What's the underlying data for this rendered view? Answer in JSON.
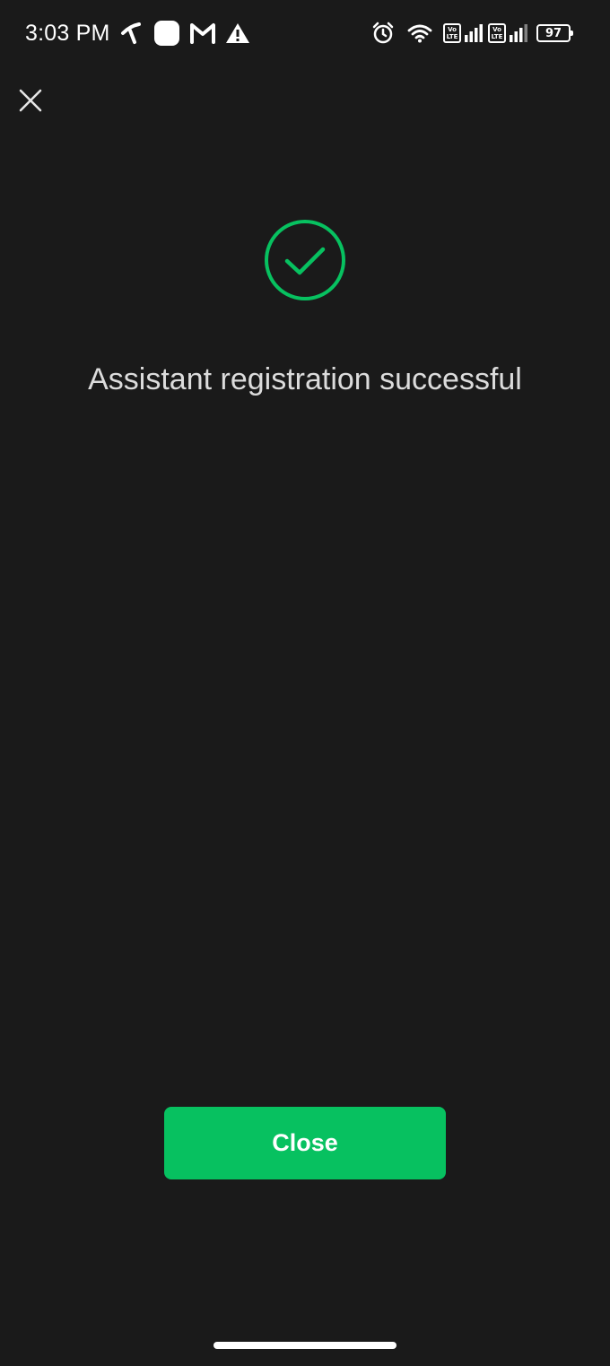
{
  "status_bar": {
    "time": "3:03 PM",
    "left_icons": [
      "carrier-icon",
      "notification-square-icon",
      "gmail-icon",
      "warning-icon"
    ],
    "right_icons": [
      "alarm-icon",
      "wifi-icon",
      "volte-icon",
      "signal-icon",
      "volte-icon",
      "signal-icon"
    ],
    "volte_label_top": "Vo",
    "volte_label_bottom": "LTE",
    "battery_level": "97"
  },
  "success": {
    "message": "Assistant registration successful",
    "icon": "check-circle-icon"
  },
  "actions": {
    "close_label": "Close"
  },
  "colors": {
    "background": "#1a1a1a",
    "accent": "#07c160",
    "message_text": "#dcdcdc"
  }
}
